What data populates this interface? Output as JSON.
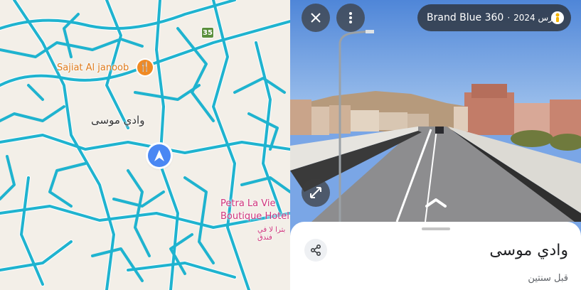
{
  "map": {
    "route_number": "35",
    "poi_name": "Sajiat Al janoob",
    "poi_icon": "restaurant-icon",
    "place_name": "وادي موسى",
    "hotel_name_line1": "Petra La Vie",
    "hotel_name_line2": "Boutique Hotel",
    "hotel_name_ar": "بترا لا في فندق",
    "road_color": "#1fb3cf",
    "pin_color": "#f08a24",
    "marker_color": "#4a87f3"
  },
  "streetview": {
    "title": "Brand Blue 360",
    "separator": "·",
    "date": "مارس 2024",
    "close_icon": "close-icon",
    "more_icon": "more-vert-icon",
    "expand_icon": "expand-icon",
    "pegman_icon": "pegman-icon",
    "nav_icon": "chevron-up-icon"
  },
  "sheet": {
    "title": "وادي موسى",
    "subtitle": "قبل سنتين",
    "share_icon": "share-icon"
  }
}
